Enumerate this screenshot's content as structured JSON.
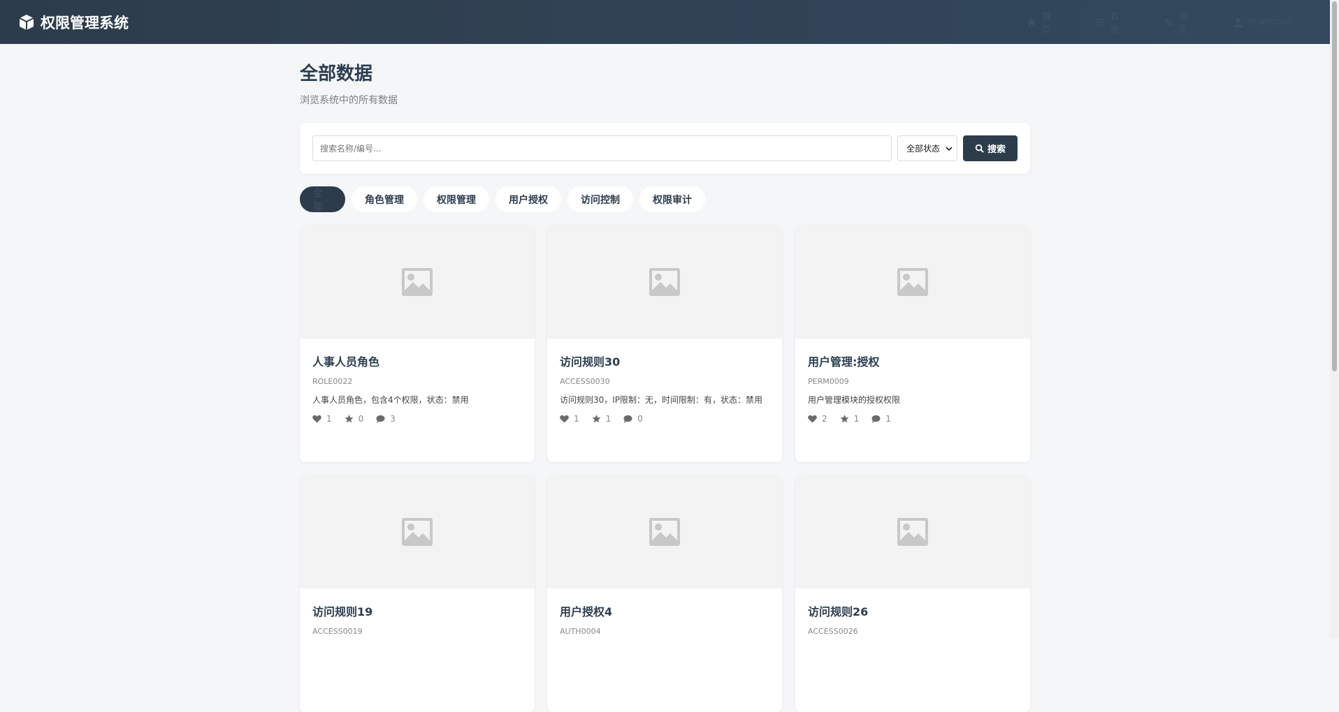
{
  "brand": {
    "title": "权限管理系统"
  },
  "nav": [
    {
      "label": "首页",
      "icon": "home-icon"
    },
    {
      "label": "数据",
      "icon": "list-icon"
    },
    {
      "label": "消息",
      "icon": "exchange-icon"
    },
    {
      "label": "zhangsan",
      "icon": "user-icon"
    }
  ],
  "page": {
    "title": "全部数据",
    "subtitle": "浏览系统中的所有数据"
  },
  "search": {
    "placeholder": "搜索名称/编号...",
    "status_selected": "全部状态",
    "button_label": "搜索"
  },
  "tabs": [
    {
      "label": "全部",
      "active": true
    },
    {
      "label": "角色管理"
    },
    {
      "label": "权限管理"
    },
    {
      "label": "用户授权"
    },
    {
      "label": "访问控制"
    },
    {
      "label": "权限审计"
    }
  ],
  "cards": [
    {
      "title": "人事人员角色",
      "code": "ROLE0022",
      "desc": "人事人员角色，包含4个权限，状态：禁用",
      "likes": "1",
      "stars": "0",
      "comments": "3"
    },
    {
      "title": "访问规则30",
      "code": "ACCESS0030",
      "desc": "访问规则30，IP限制：无，时间限制：有，状态：禁用",
      "likes": "1",
      "stars": "1",
      "comments": "0"
    },
    {
      "title": "用户管理:授权",
      "code": "PERM0009",
      "desc": "用户管理模块的授权权限",
      "likes": "2",
      "stars": "1",
      "comments": "1"
    },
    {
      "title": "访问规则19",
      "code": "ACCESS0019",
      "desc": "",
      "likes": "",
      "stars": "",
      "comments": ""
    },
    {
      "title": "用户授权4",
      "code": "AUTH0004",
      "desc": "",
      "likes": "",
      "stars": "",
      "comments": ""
    },
    {
      "title": "访问规则26",
      "code": "ACCESS0026",
      "desc": "",
      "likes": "",
      "stars": "",
      "comments": ""
    }
  ]
}
